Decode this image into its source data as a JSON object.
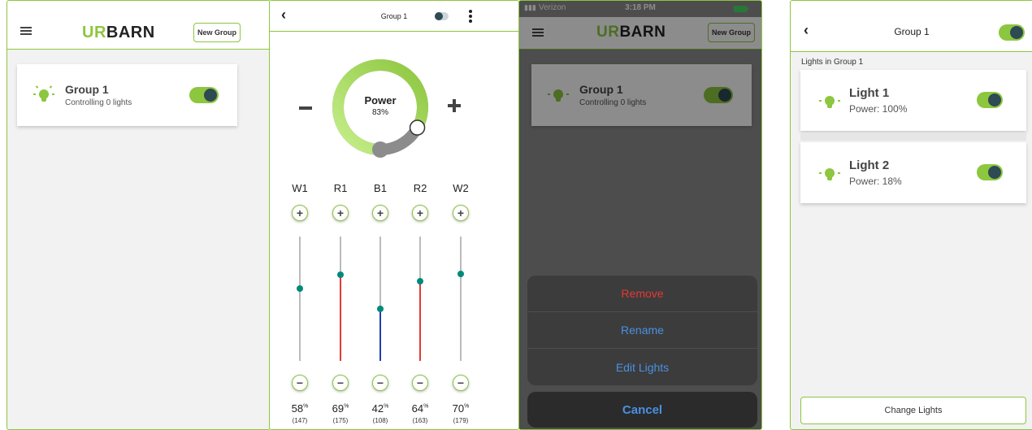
{
  "brand": {
    "logo_u": "UR",
    "logo_rest": "BARN",
    "accent": "#8dc63f",
    "dark": "#2e4a52"
  },
  "screen1": {
    "new_group_label": "New Group",
    "group": {
      "name": "Group 1",
      "subtitle": "Controlling 0 lights",
      "enabled": true
    }
  },
  "screen2": {
    "title": "Group 1",
    "power_label": "Power",
    "power_value": "83%",
    "power_level": 0.83,
    "channels": [
      {
        "name": "W1",
        "percent": "58",
        "raw": "(147)",
        "level": 0.58,
        "color": "#bbbbbb"
      },
      {
        "name": "R1",
        "percent": "69",
        "raw": "(175)",
        "level": 0.69,
        "color": "#e53935"
      },
      {
        "name": "B1",
        "percent": "42",
        "raw": "(108)",
        "level": 0.42,
        "color": "#1e3fb0"
      },
      {
        "name": "R2",
        "percent": "64",
        "raw": "(163)",
        "level": 0.64,
        "color": "#e53935"
      },
      {
        "name": "W2",
        "percent": "70",
        "raw": "(179)",
        "level": 0.7,
        "color": "#bbbbbb"
      }
    ],
    "percent_suffix": "%"
  },
  "screen3": {
    "carrier": "Verizon",
    "time": "3:18 PM",
    "new_group_label": "New Group",
    "group": {
      "name": "Group 1",
      "subtitle": "Controlling 0 lights"
    },
    "actions": [
      {
        "label": "Remove",
        "color": "#e53935"
      },
      {
        "label": "Rename",
        "color": "#4a90e2"
      },
      {
        "label": "Edit Lights",
        "color": "#4a90e2"
      }
    ],
    "cancel_label": "Cancel"
  },
  "screen4": {
    "title": "Group 1",
    "section_label": "Lights in Group 1",
    "lights": [
      {
        "name": "Light 1",
        "power": "Power: 100%"
      },
      {
        "name": "Light 2",
        "power": "Power: 18%"
      }
    ],
    "change_label": "Change Lights"
  }
}
